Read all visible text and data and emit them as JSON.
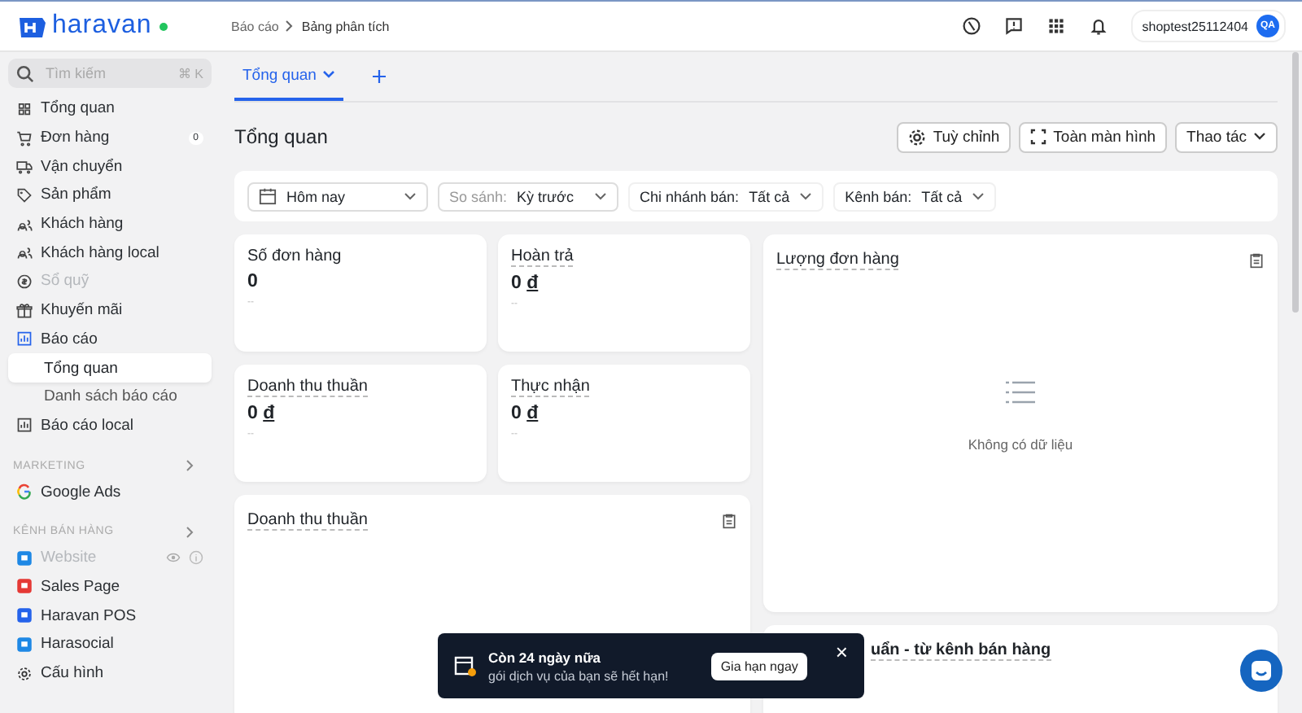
{
  "header": {
    "brand": "haravan",
    "online": true,
    "breadcrumb": [
      "Báo cáo",
      "Bảng phân tích"
    ],
    "user": {
      "name": "shoptest25112404",
      "initials": "QA"
    }
  },
  "sidebar": {
    "search": {
      "placeholder": "Tìm kiếm",
      "shortcut": "⌘ K"
    },
    "items": [
      {
        "label": "Tổng quan",
        "disabled": false,
        "selected": false
      },
      {
        "label": "Đơn hàng",
        "badge": "0",
        "disabled": false,
        "selected": false
      },
      {
        "label": "Vận chuyển",
        "disabled": false,
        "selected": false
      },
      {
        "label": "Sản phẩm",
        "disabled": false,
        "selected": false
      },
      {
        "label": "Khách hàng",
        "disabled": false,
        "selected": false
      },
      {
        "label": "Khách hàng local",
        "disabled": false,
        "selected": false
      },
      {
        "label": "Sổ quỹ",
        "disabled": true,
        "selected": false
      },
      {
        "label": "Khuyến mãi",
        "disabled": false,
        "selected": false
      },
      {
        "label": "Báo cáo",
        "disabled": false,
        "selected": false,
        "expanded": true,
        "children": [
          {
            "label": "Tổng quan",
            "selected": true
          },
          {
            "label": "Danh sách báo cáo",
            "selected": false
          }
        ]
      },
      {
        "label": "Báo cáo local",
        "disabled": false,
        "selected": false
      }
    ],
    "sections": [
      {
        "title": "MARKETING",
        "items": [
          {
            "label": "Google Ads",
            "kind": "google",
            "disabled": false
          }
        ]
      },
      {
        "title": "KÊNH BÁN HÀNG",
        "items": [
          {
            "label": "Website",
            "kind": "app",
            "color": "#1e88e5",
            "disabled": true
          },
          {
            "label": "Sales Page",
            "kind": "app",
            "color": "#e53935",
            "disabled": false
          },
          {
            "label": "Haravan POS",
            "kind": "app",
            "color": "#2563eb",
            "disabled": false
          },
          {
            "label": "Harasocial",
            "kind": "app",
            "color": "#1e88e5",
            "disabled": false
          }
        ]
      }
    ],
    "footer": {
      "label": "Cấu hình"
    }
  },
  "tabs": [
    {
      "label": "Tổng quan",
      "selected": true
    }
  ],
  "page": {
    "title": "Tổng quan",
    "actions": [
      "Tuỳ chỉnh",
      "Toàn màn hình",
      "Thao tác"
    ]
  },
  "filters": {
    "date": "Hôm nay",
    "compare": {
      "label": "So sánh:",
      "value": "Kỳ trước"
    },
    "branch": {
      "label": "Chi nhánh bán:",
      "value": "Tất cả"
    },
    "channel": {
      "label": "Kênh bán:",
      "value": "Tất cả"
    }
  },
  "metrics": [
    {
      "title": "Số đơn hàng",
      "value": "0",
      "sub": "--"
    },
    {
      "title": "Hoàn trả",
      "value": "0",
      "currency": "đ",
      "sub": "--"
    },
    {
      "title": "Doanh thu thuần",
      "value": "0",
      "currency": "đ",
      "sub": "--"
    },
    {
      "title": "Thực nhận",
      "value": "0",
      "currency": "đ",
      "sub": "--"
    }
  ],
  "panels": [
    {
      "title": "Lượng đơn hàng",
      "empty": "Không có dữ liệu"
    },
    {
      "title": "Doanh thu thuần"
    },
    {
      "title": "uẩn - từ kênh bán hàng"
    }
  ],
  "toast": {
    "title": "Còn 24 ngày nữa",
    "message": "gói dịch vụ của bạn sẽ hết hạn!",
    "action": "Gia hạn ngay",
    "close": "×"
  }
}
